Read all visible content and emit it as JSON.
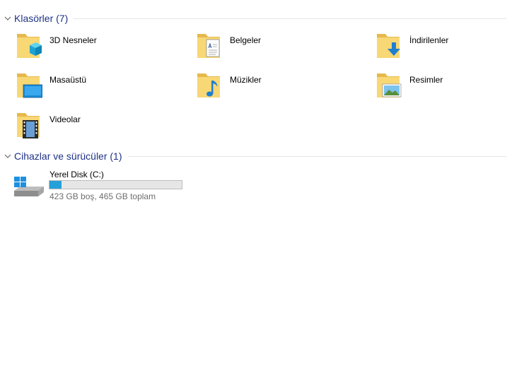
{
  "groups": {
    "folders": {
      "title": "Klasörler (7)"
    },
    "devices": {
      "title": "Cihazlar ve sürücüler (1)"
    }
  },
  "folders": [
    {
      "name": "3D Nesneler",
      "icon": "3d-objects-folder-icon"
    },
    {
      "name": "Belgeler",
      "icon": "documents-folder-icon"
    },
    {
      "name": "İndirilenler",
      "icon": "downloads-folder-icon"
    },
    {
      "name": "Masaüstü",
      "icon": "desktop-folder-icon"
    },
    {
      "name": "Müzikler",
      "icon": "music-folder-icon"
    },
    {
      "name": "Resimler",
      "icon": "pictures-folder-icon"
    },
    {
      "name": "Videolar",
      "icon": "videos-folder-icon"
    }
  ],
  "drive": {
    "name": "Yerel Disk (C:)",
    "space_text": "423 GB boş, 465 GB toplam",
    "used_fraction": 0.09,
    "icon": "hard-drive-icon"
  },
  "colors": {
    "header_text": "#1e3287",
    "folder_yellow": "#f8d775",
    "bar_fill": "#26a0da",
    "subtext": "#6d6d6d"
  }
}
